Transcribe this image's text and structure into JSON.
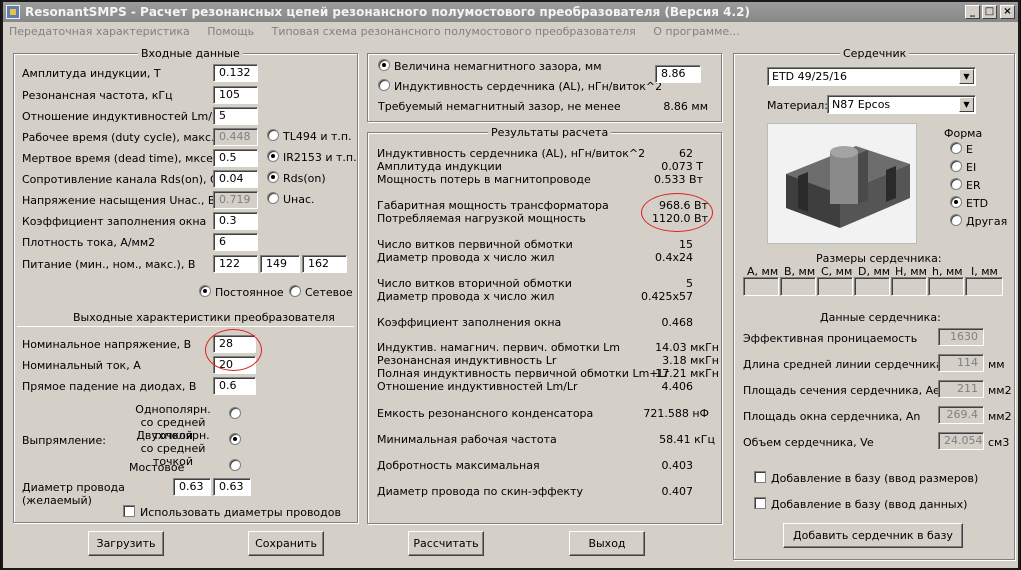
{
  "window": {
    "title": "ResonantSMPS - Расчет резонансных цепей резонансного полумостового преобразователя (Версия 4.2)",
    "minimize": "_",
    "maximize": "□",
    "close": "×"
  },
  "menu": [
    "Передаточная характеристика",
    "Помощь",
    "Типовая схема резонансного полумостового преобразователя",
    "О программе..."
  ],
  "input": {
    "title": "Входные данные",
    "rows": [
      {
        "label": "Амплитуда индукции, Т",
        "value": "0.132"
      },
      {
        "label": "Резонансная частота, кГц",
        "value": "105"
      },
      {
        "label": "Отношение индуктивностей Lm/Lr",
        "value": "5"
      },
      {
        "label": "Рабочее время (duty cycle), макс.",
        "value": "0.448"
      },
      {
        "label": "Мертвое время (dead time), мксек",
        "value": "0.5"
      },
      {
        "label": "Сопротивление канала Rds(on), Ом",
        "value": "0.04"
      },
      {
        "label": "Напряжение насыщения Uнас., В",
        "value": "0.719"
      },
      {
        "label": "Коэффициент заполнения окна",
        "value": "0.3"
      },
      {
        "label": "Плотность тока, А/мм2",
        "value": "6"
      }
    ],
    "supply_label": "Питание (мин., ном., макс.), В",
    "supply": [
      "122",
      "149",
      "162"
    ],
    "driver": [
      "TL494 и т.п.",
      "IR2153 и т.п."
    ],
    "loss": [
      "Rds(on)",
      "Uнас."
    ],
    "dc_label": "Постоянное",
    "ac_label": "Сетевое"
  },
  "output": {
    "title": "Выходные характеристики преобразователя",
    "voltage_label": "Номинальное напряжение, В",
    "voltage": "28",
    "current_label": "Номинальный ток, А",
    "current": "20",
    "diode_label": "Прямое падение на диодах, В",
    "diode": "0.6",
    "rect_label": "Выпрямление:",
    "rect_opts": [
      "Однополярн. со средней точкой",
      "Двухполярн. со средней точкой",
      "Мостовое"
    ],
    "wire_label": "Диаметр провода (желаемый)",
    "wire": [
      "0.63",
      "0.63"
    ],
    "use_wire": "Использовать диаметры проводов"
  },
  "gap": {
    "opt1": "Величина немагнитного зазора, мм",
    "opt2": "Индуктивность сердечника (AL), нГн/виток^2",
    "al_value": "8.86",
    "req_label": "Требуемый немагнитный зазор, не менее",
    "req_value": "8.86 мм"
  },
  "results": {
    "title": "Результаты расчета",
    "items": [
      {
        "label": "Индуктивность сердечника (AL), нГн/виток^2",
        "value": "62"
      },
      {
        "label": "Амплитуда индукции",
        "value": "0.073 Т"
      },
      {
        "label": "Мощность потерь в магнитопроводе",
        "value": "0.533 Вт"
      },
      {
        "label": "Габаритная мощность трансформатора",
        "value": "968.6 Вт"
      },
      {
        "label": "Потребляемая нагрузкой мощность",
        "value": "1120.0 Вт"
      },
      {
        "label": "Число витков первичной обмотки",
        "value": "15"
      },
      {
        "label": "Диаметр провода х число жил",
        "value": "0.4x24"
      },
      {
        "label": "Число витков вторичной обмотки",
        "value": "5"
      },
      {
        "label": "Диаметр провода х число жил",
        "value": "0.425x57"
      },
      {
        "label": "Коэффициент заполнения окна",
        "value": "0.468"
      },
      {
        "label": "Индуктив. намагнич. первич. обмотки Lm",
        "value": "14.03 мкГн"
      },
      {
        "label": "Резонансная индуктивность Lr",
        "value": "3.18 мкГн"
      },
      {
        "label": "Полная индуктивность первичной обмотки  Lm+Lr",
        "value": "17.21 мкГн"
      },
      {
        "label": "Отношение индуктивностей Lm/Lr",
        "value": "4.406"
      },
      {
        "label": "Емкость резонансного конденсатора",
        "value": "721.588 нФ"
      },
      {
        "label": "Минимальная рабочая частота",
        "value": "58.41 кГц"
      },
      {
        "label": "Добротность максимальная",
        "value": "0.403"
      },
      {
        "label": "Диаметр провода по скин-эффекту",
        "value": "0.407"
      }
    ]
  },
  "core": {
    "title": "Сердечник",
    "type": "ETD 49/25/16",
    "material_label": "Материал:",
    "material": "N87 Epcos",
    "shape_label": "Форма",
    "shapes": [
      "E",
      "EI",
      "ER",
      "ETD",
      "Другая"
    ],
    "dims_label": "Размеры сердечника:",
    "dims": [
      "A, мм",
      "B, мм",
      "C, мм",
      "D, мм",
      "H, мм",
      "h, мм",
      "I, мм"
    ],
    "data_label": "Данные сердечника:",
    "data": [
      {
        "label": "Эффективная проницаемость",
        "value": "1630",
        "unit": ""
      },
      {
        "label": "Длина средней линии сердечника, le",
        "value": "114",
        "unit": "мм"
      },
      {
        "label": "Площадь сечения сердечника, Ae",
        "value": "211",
        "unit": "мм2"
      },
      {
        "label": "Площадь окна сердечника, An",
        "value": "269.4",
        "unit": "мм2"
      },
      {
        "label": "Объем сердечника, Ve",
        "value": "24.054",
        "unit": "см3"
      }
    ],
    "add_dims": "Добавление в базу (ввод размеров)",
    "add_data": "Добавление в базу (ввод данных)",
    "add_button": "Добавить сердечник в базу"
  },
  "buttons": {
    "load": "Загрузить",
    "save": "Сохранить",
    "calc": "Рассчитать",
    "exit": "Выход"
  }
}
